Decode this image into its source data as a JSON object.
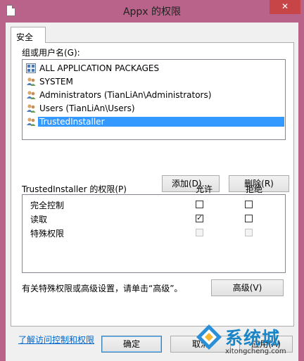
{
  "window": {
    "title": "Appx 的权限",
    "close": "✕"
  },
  "tabs": [
    {
      "label": "安全"
    }
  ],
  "groups": {
    "label": "组或用户名(G):",
    "items": [
      {
        "label": "ALL APPLICATION PACKAGES",
        "icon": "app-packages-icon"
      },
      {
        "label": "SYSTEM",
        "icon": "users-icon"
      },
      {
        "label": "Administrators (TianLiAn\\Administrators)",
        "icon": "users-icon"
      },
      {
        "label": "Users (TianLiAn\\Users)",
        "icon": "users-icon"
      },
      {
        "label": "TrustedInstaller",
        "icon": "users-icon",
        "selected": true
      }
    ]
  },
  "buttons": {
    "add": "添加(D)...",
    "remove": "删除(R)",
    "advanced": "高级(V)",
    "ok": "确定",
    "cancel": "取消",
    "apply": "应用(A)"
  },
  "permissions": {
    "header": "TrustedInstaller 的权限(P)",
    "allow": "允许",
    "deny": "拒绝",
    "rows": [
      {
        "name": "完全控制",
        "allow": false,
        "deny": false,
        "disabled": false
      },
      {
        "name": "读取",
        "allow": true,
        "deny": false,
        "disabled": false
      },
      {
        "name": "特殊权限",
        "allow": false,
        "deny": false,
        "disabled": true
      }
    ]
  },
  "advanced_hint": "有关特殊权限或高级设置，请单击“高级”。",
  "link": "了解访问控制和权限",
  "watermark": {
    "brand": "系统城",
    "site": "xitongcheng.com"
  },
  "colors": {
    "frame": "#b9628a",
    "selection": "#3399ff",
    "close": "#c74547",
    "link": "#0066cc",
    "watermark": "#1a86c8"
  }
}
